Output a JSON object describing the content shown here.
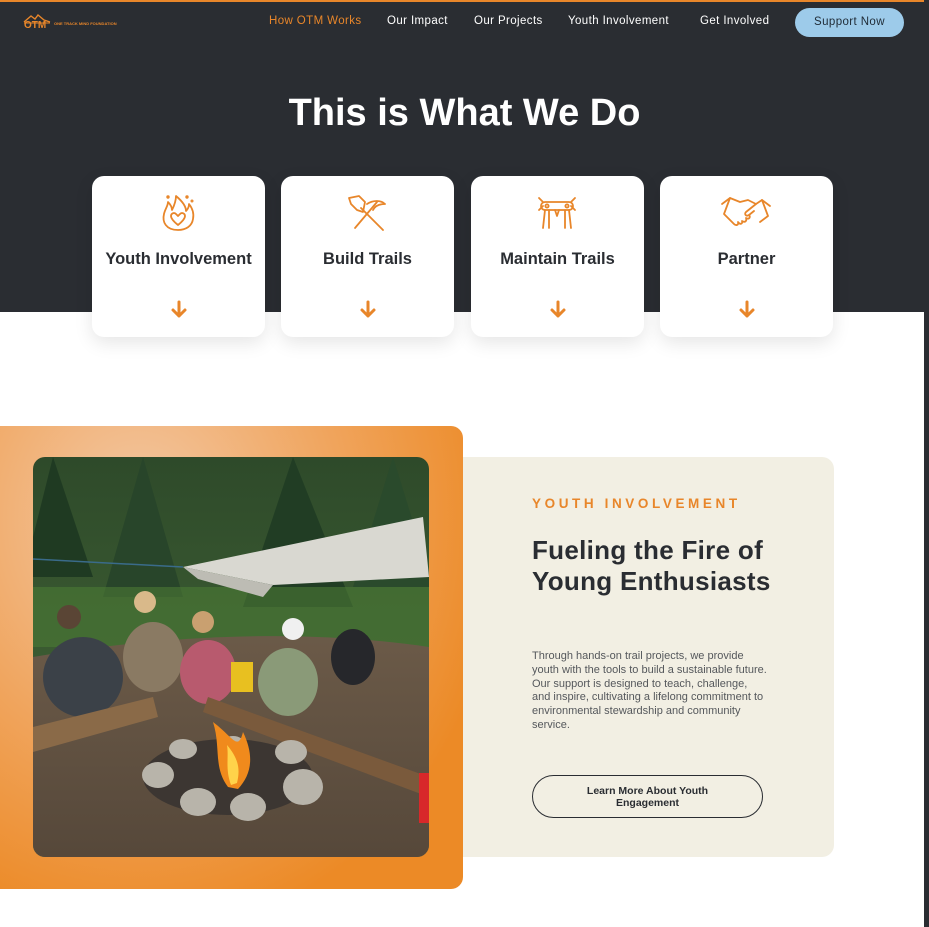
{
  "header": {
    "logo_text": "OTM",
    "logo_subtext": "ONE TRACK MIND FOUNDATION",
    "nav": [
      "How OTM Works",
      "Our Impact",
      "Our Projects",
      "Youth Involvement",
      "Get Involved"
    ],
    "active_nav": "How OTM Works",
    "support_label": "Support Now"
  },
  "hero": {
    "title": "This is What We Do",
    "cards": [
      {
        "label": "Youth Involvement",
        "icon": "flame-heart-icon"
      },
      {
        "label": "Build Trails",
        "icon": "pickaxe-shovel-icon"
      },
      {
        "label": "Maintain Trails",
        "icon": "hands-carrying-log-icon"
      },
      {
        "label": "Partner",
        "icon": "handshake-icon"
      }
    ]
  },
  "feature": {
    "eyebrow": "YOUTH INVOLVEMENT",
    "headline": "Fueling the Fire of Young Enthusiasts",
    "body": "Through hands-on trail projects, we provide youth with the tools to build a sustainable future. Our support is designed to teach, challenge, and inspire, cultivating a lifelong commitment to environmental stewardship and community service.",
    "cta_label": "Learn More About Youth Engagement",
    "photo": "youth-campfire-photo"
  },
  "colors": {
    "accent": "#e8862a",
    "dark": "#2a2d32",
    "button_blue": "#9dcbea",
    "panel": "#f2efe3"
  }
}
